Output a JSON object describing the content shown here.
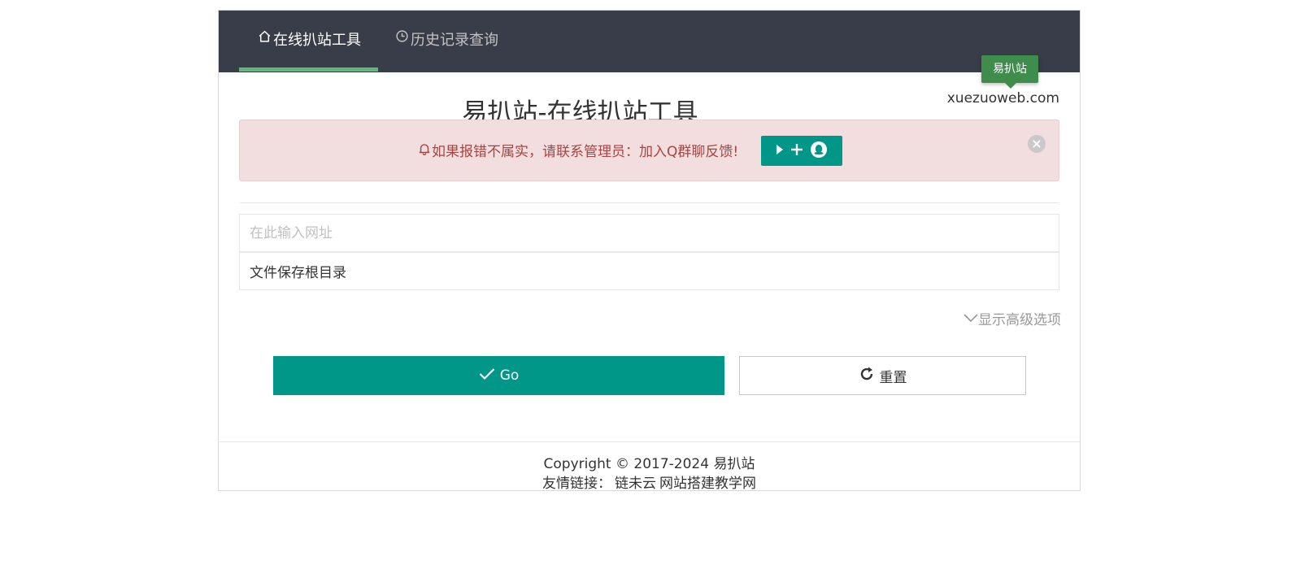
{
  "tabs": [
    {
      "label": "在线扒站工具",
      "icon": "home-icon",
      "active": true
    },
    {
      "label": "历史记录查询",
      "icon": "clock-icon",
      "active": false
    }
  ],
  "tooltip": {
    "text": "易扒站"
  },
  "domain": "xuezuoweb.com",
  "page_title": "易扒站-在线扒站工具",
  "alert": {
    "text": "如果报错不属实，请联系管理员：加入Q群聊反馈!",
    "icon": "bell-icon",
    "button_icons": [
      "play-icon",
      "plus-icon",
      "qq-icon"
    ],
    "close_icon": "close-icon"
  },
  "form": {
    "url_placeholder": "在此输入网址",
    "url_value": "",
    "dir_value": "文件保存根目录",
    "advanced_label": "显示高级选项"
  },
  "buttons": {
    "go_label": "Go",
    "reset_label": "重置"
  },
  "footer": {
    "copyright": "Copyright © 2017-2024 易扒站",
    "links_label": "友情链接：",
    "links": [
      "链未云",
      "网站搭建教学网"
    ]
  },
  "colors": {
    "tabbar_bg": "#393d49",
    "active_underline": "#5fb878",
    "primary": "#009688",
    "tooltip_bg": "#3f8d4d",
    "alert_bg": "#f2dede",
    "alert_text": "#a94442"
  }
}
